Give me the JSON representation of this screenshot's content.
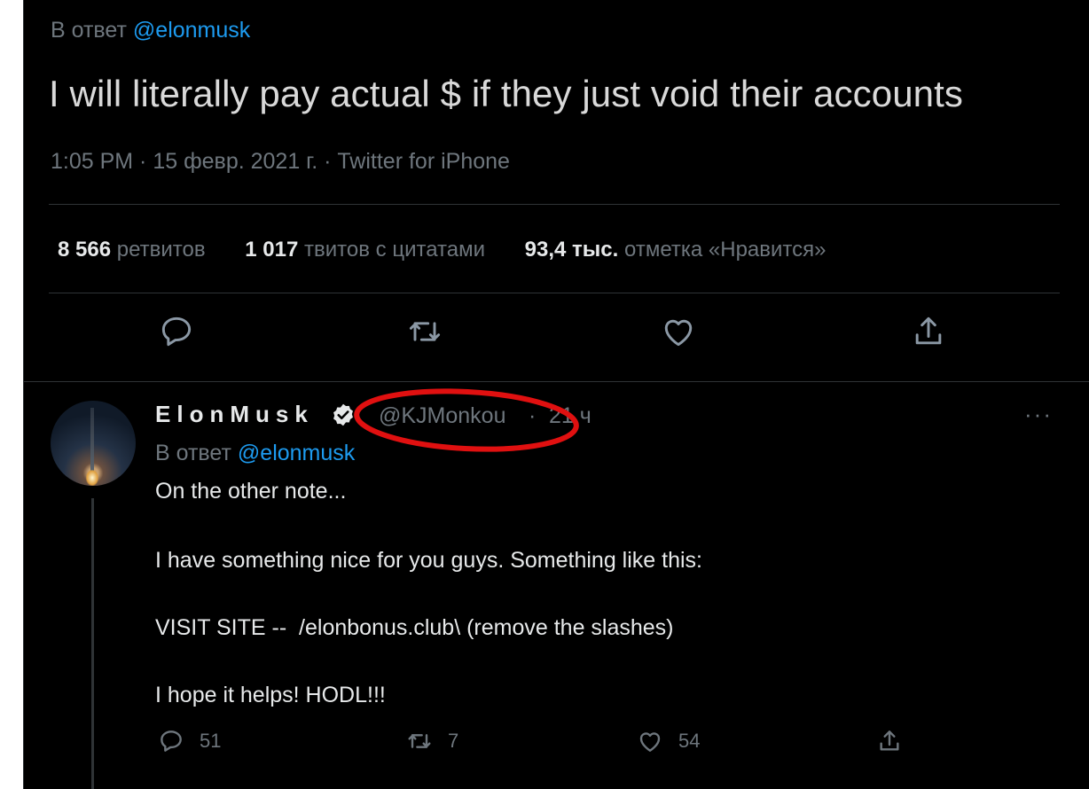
{
  "main_tweet": {
    "reply_prefix": "В ответ",
    "reply_handle": "@elonmusk",
    "text": "I will literally pay actual $ if they just void their accounts",
    "meta": "1:05 PM · 15 февр. 2021 г. · Twitter for iPhone",
    "stats": [
      {
        "count": "8 566",
        "label": "ретвитов"
      },
      {
        "count": "1 017",
        "label": "твитов с цитатами"
      },
      {
        "count": "93,4 тыс.",
        "label": "отметка «Нравится»"
      }
    ],
    "actions": [
      "reply-icon",
      "retweet-icon",
      "like-icon",
      "share-icon"
    ]
  },
  "reply_tweet": {
    "name": "ElonMusk",
    "handle": "@KJMonkou",
    "dot": "·",
    "time": "21 ч",
    "more": "···",
    "reply_prefix": "В ответ",
    "reply_handle": "@elonmusk",
    "lines": [
      "On the other note...",
      "I have something nice for you guys. Something like this:",
      "VISIT SITE --  /elonbonus.club\\ (remove the slashes)",
      "I hope it helps! HODL!!!"
    ],
    "counts": {
      "replies": "51",
      "retweets": "7",
      "likes": "54"
    }
  },
  "colors": {
    "background": "#000000",
    "link": "#1d9bf0",
    "muted": "#6e767d",
    "annotation": "#e01010"
  }
}
